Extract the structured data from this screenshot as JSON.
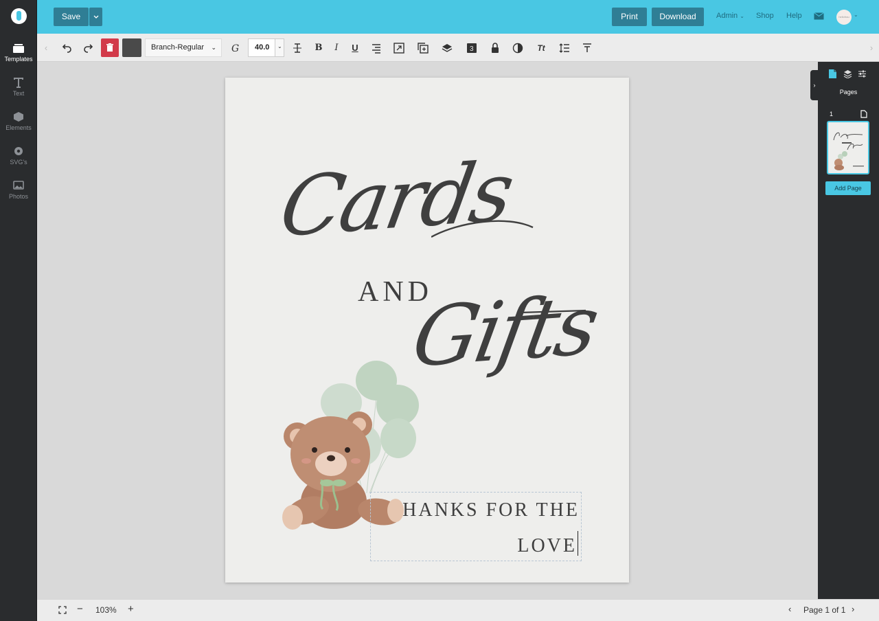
{
  "sidebar": {
    "items": [
      {
        "label": "Templates",
        "icon": "templates-icon"
      },
      {
        "label": "Text",
        "icon": "text-icon"
      },
      {
        "label": "Elements",
        "icon": "elements-icon"
      },
      {
        "label": "SVG's",
        "icon": "svg-icon"
      },
      {
        "label": "Photos",
        "icon": "photos-icon"
      }
    ]
  },
  "header": {
    "save_label": "Save",
    "print_label": "Print",
    "download_label": "Download",
    "admin_label": "Admin",
    "shop_label": "Shop",
    "help_label": "Help",
    "avatar_text": "hellofrau"
  },
  "toolbar": {
    "font_name": "Branch-Regular",
    "font_size": "40.0",
    "italic_label": "I",
    "bold_label": "B",
    "underline_label": "U",
    "tt_label": "Tt",
    "accent_color": "#49c7e3",
    "delete_color": "#d23a4a",
    "text_color_swatch": "#4a4a4a"
  },
  "canvas": {
    "script_line1": "Cards",
    "and_text": "AND",
    "script_line2": "Gifts",
    "thanks_line1": "HANKS FOR THE",
    "thanks_line2": "LOVE"
  },
  "right_panel": {
    "pages_label": "Pages",
    "page_number": "1",
    "add_page_label": "Add Page"
  },
  "bottom": {
    "zoom": "103%",
    "page_indicator": "Page 1 of 1"
  }
}
